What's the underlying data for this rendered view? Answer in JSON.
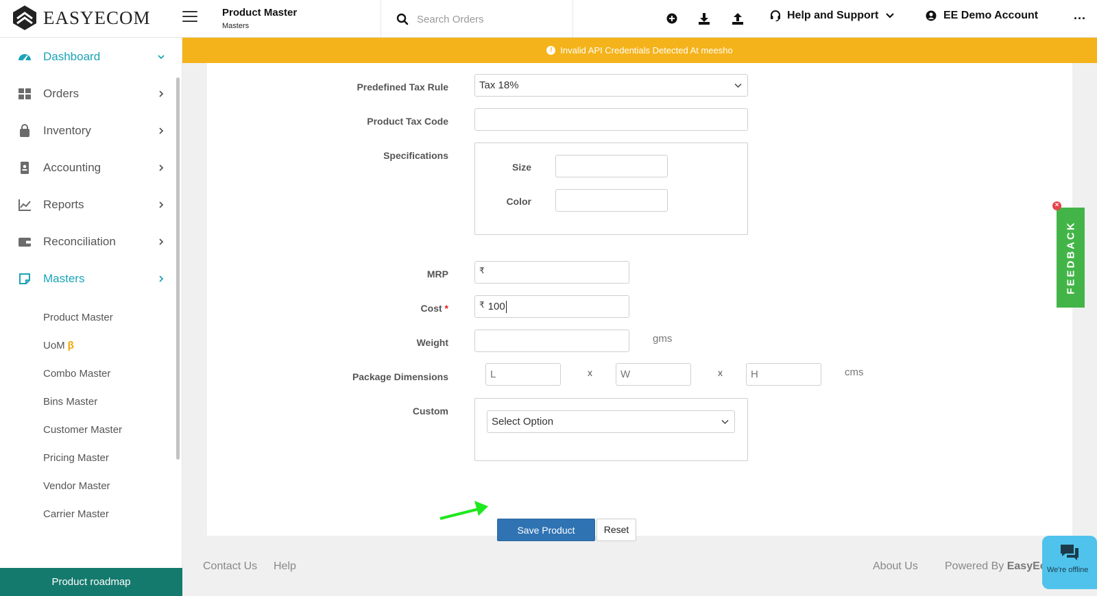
{
  "app": {
    "brand": "EASYECOM"
  },
  "header": {
    "page_title": "Product Master",
    "page_subtitle": "Masters",
    "search_placeholder": "Search Orders",
    "help_label": "Help and Support",
    "account_label": "EE Demo Account",
    "more_label": "..."
  },
  "alert": {
    "text": "Invalid API Credentials Detected At meesho",
    "color": "#f4b31a"
  },
  "sidebar": {
    "items": [
      {
        "label": "Dashboard",
        "icon": "dashboard-icon"
      },
      {
        "label": "Orders",
        "icon": "orders-grid-icon"
      },
      {
        "label": "Inventory",
        "icon": "bag-icon"
      },
      {
        "label": "Accounting",
        "icon": "ledger-icon"
      },
      {
        "label": "Reports",
        "icon": "line-chart-icon"
      },
      {
        "label": "Reconciliation",
        "icon": "wallet-icon"
      },
      {
        "label": "Masters",
        "icon": "note-icon"
      }
    ],
    "masters_sub": [
      {
        "label": "Product Master"
      },
      {
        "label": "UoM",
        "badge": "β"
      },
      {
        "label": "Combo Master"
      },
      {
        "label": "Bins Master"
      },
      {
        "label": "Customer Master"
      },
      {
        "label": "Pricing Master"
      },
      {
        "label": "Vendor Master"
      },
      {
        "label": "Carrier Master"
      }
    ],
    "roadmap_label": "Product roadmap",
    "accent_color": "#1aa3b6"
  },
  "form": {
    "tax_rule": {
      "label": "Predefined Tax Rule",
      "value": "Tax 18%"
    },
    "tax_code": {
      "label": "Product Tax Code",
      "value": ""
    },
    "specifications": {
      "label": "Specifications",
      "size_label": "Size",
      "size_value": "",
      "color_label": "Color",
      "color_value": ""
    },
    "mrp": {
      "label": "MRP",
      "currency": "₹",
      "value": ""
    },
    "cost": {
      "label": "Cost",
      "required_mark": "*",
      "currency": "₹",
      "value": "100"
    },
    "weight": {
      "label": "Weight",
      "value": "",
      "unit": "gms"
    },
    "package": {
      "label": "Package Dimensions",
      "l_placeholder": "L",
      "w_placeholder": "W",
      "h_placeholder": "H",
      "separator": "x",
      "unit": "cms"
    },
    "custom": {
      "label": "Custom",
      "value": "Select Option"
    },
    "save_label": "Save Product",
    "reset_label": "Reset",
    "save_color": "#2f73b3"
  },
  "footer": {
    "contact": "Contact Us",
    "help": "Help",
    "about": "About Us",
    "powered_prefix": "Powered By",
    "powered_brand": "EasyEc"
  },
  "feedback": {
    "label": "FEEDBACK",
    "close": "×",
    "color": "#43b548"
  },
  "chat": {
    "status": "We're offline"
  }
}
